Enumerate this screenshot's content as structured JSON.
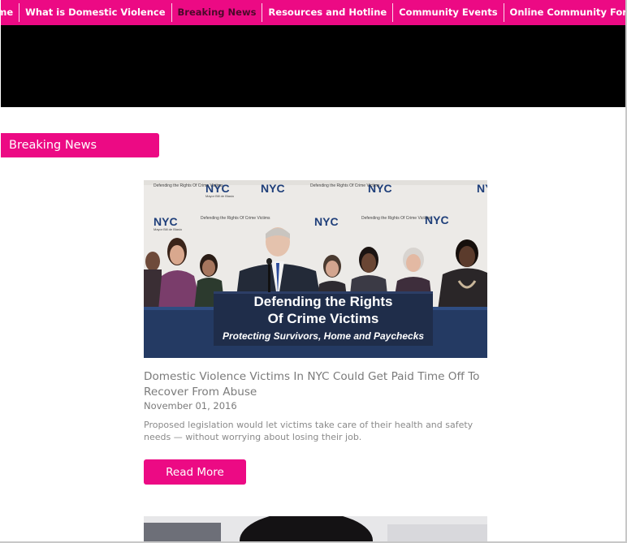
{
  "nav": {
    "items": [
      {
        "label": "Home"
      },
      {
        "label": "What is Domestic Violence"
      },
      {
        "label": "Breaking News"
      },
      {
        "label": "Resources and Hotline"
      },
      {
        "label": "Community Events"
      },
      {
        "label": "Online Community Forum"
      }
    ],
    "active_index": 2
  },
  "section": {
    "label": "Breaking News"
  },
  "article": {
    "photo": {
      "backdrop_text": "NYC",
      "backdrop_caption": "Defending the Rights Of Crime Victims",
      "backdrop_small": "Mayor Bill de Blasio",
      "podium_line1": "Defending the Rights",
      "podium_line2": "Of Crime Victims",
      "podium_line3": "Protecting Survivors, Home and Paychecks"
    },
    "title": "Domestic Violence Victims In NYC Could Get Paid Time Off To Recover From Abuse",
    "date": "November 01, 2016",
    "summary": "Proposed legislation would let victims take care of their health and safety needs — without worrying about losing their job.",
    "read_more_label": "Read More"
  },
  "colors": {
    "brand_pink": "#ec0a84",
    "nav_active_text": "#4a0a2a",
    "banner": "#000000",
    "muted_text": "#7b7b7b",
    "podium_blue": "#1f2d4a"
  },
  "icons": []
}
